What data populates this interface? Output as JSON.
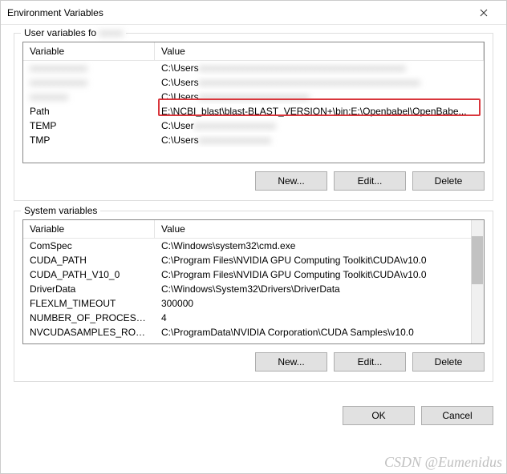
{
  "window": {
    "title": "Environment Variables"
  },
  "user_section": {
    "legend": "User variables fo",
    "columns": {
      "variable": "Variable",
      "value": "Value"
    },
    "rows": [
      {
        "variable": "",
        "value": "C:\\Users",
        "blur": true
      },
      {
        "variable": "",
        "value": "C:\\Users",
        "blur_var": true,
        "partial_blur": true
      },
      {
        "variable": "",
        "value": "C:\\Users",
        "blur": true
      },
      {
        "variable": "Path",
        "value": "E:\\NCBI_blast\\blast-BLAST_VERSION+\\bin;E:\\Openbabel\\OpenBabe..."
      },
      {
        "variable": "TEMP",
        "value": "C:\\User",
        "partial_blur": true
      },
      {
        "variable": "TMP",
        "value": "C:\\Users",
        "partial_blur": true
      }
    ],
    "buttons": {
      "new": "New...",
      "edit": "Edit...",
      "delete": "Delete"
    }
  },
  "system_section": {
    "legend": "System variables",
    "columns": {
      "variable": "Variable",
      "value": "Value"
    },
    "rows": [
      {
        "variable": "ComSpec",
        "value": "C:\\Windows\\system32\\cmd.exe"
      },
      {
        "variable": "CUDA_PATH",
        "value": "C:\\Program Files\\NVIDIA GPU Computing Toolkit\\CUDA\\v10.0"
      },
      {
        "variable": "CUDA_PATH_V10_0",
        "value": "C:\\Program Files\\NVIDIA GPU Computing Toolkit\\CUDA\\v10.0"
      },
      {
        "variable": "DriverData",
        "value": "C:\\Windows\\System32\\Drivers\\DriverData"
      },
      {
        "variable": "FLEXLM_TIMEOUT",
        "value": "300000"
      },
      {
        "variable": "NUMBER_OF_PROCESSORS",
        "value": "4"
      },
      {
        "variable": "NVCUDASAMPLES_ROOT",
        "value": "C:\\ProgramData\\NVIDIA Corporation\\CUDA Samples\\v10.0"
      }
    ],
    "buttons": {
      "new": "New...",
      "edit": "Edit...",
      "delete": "Delete"
    }
  },
  "footer": {
    "ok": "OK",
    "cancel": "Cancel"
  },
  "watermark": "CSDN @Eumenidus"
}
